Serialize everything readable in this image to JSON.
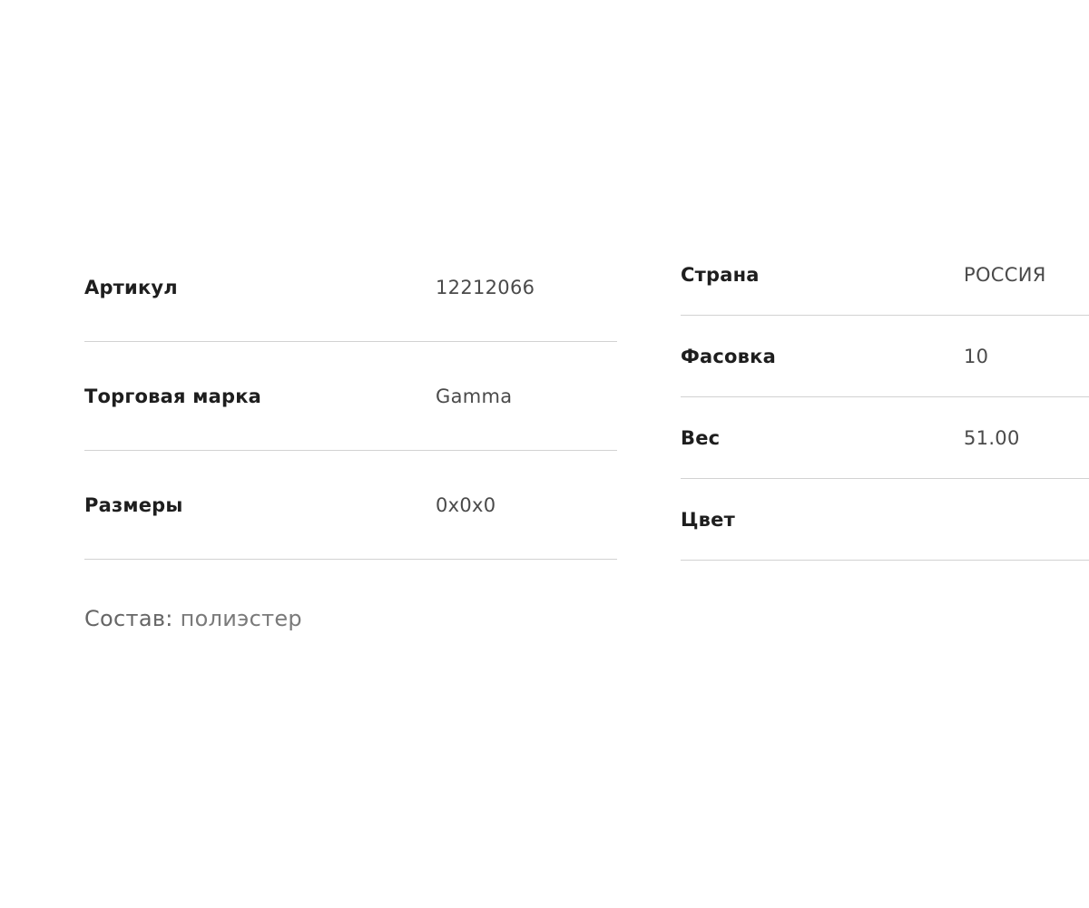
{
  "specs": {
    "left": [
      {
        "label": "Артикул",
        "value": "12212066"
      },
      {
        "label": "Торговая марка",
        "value": "Gamma"
      },
      {
        "label": "Размеры",
        "value": "0x0x0"
      }
    ],
    "right": [
      {
        "label": "Страна",
        "value": "РОССИЯ"
      },
      {
        "label": "Фасовка",
        "value": "10"
      },
      {
        "label": "Вес",
        "value": "51.00"
      },
      {
        "label": "Цвет",
        "value": ""
      }
    ]
  },
  "composition": {
    "label": "Состав:",
    "value": "полиэстер"
  }
}
